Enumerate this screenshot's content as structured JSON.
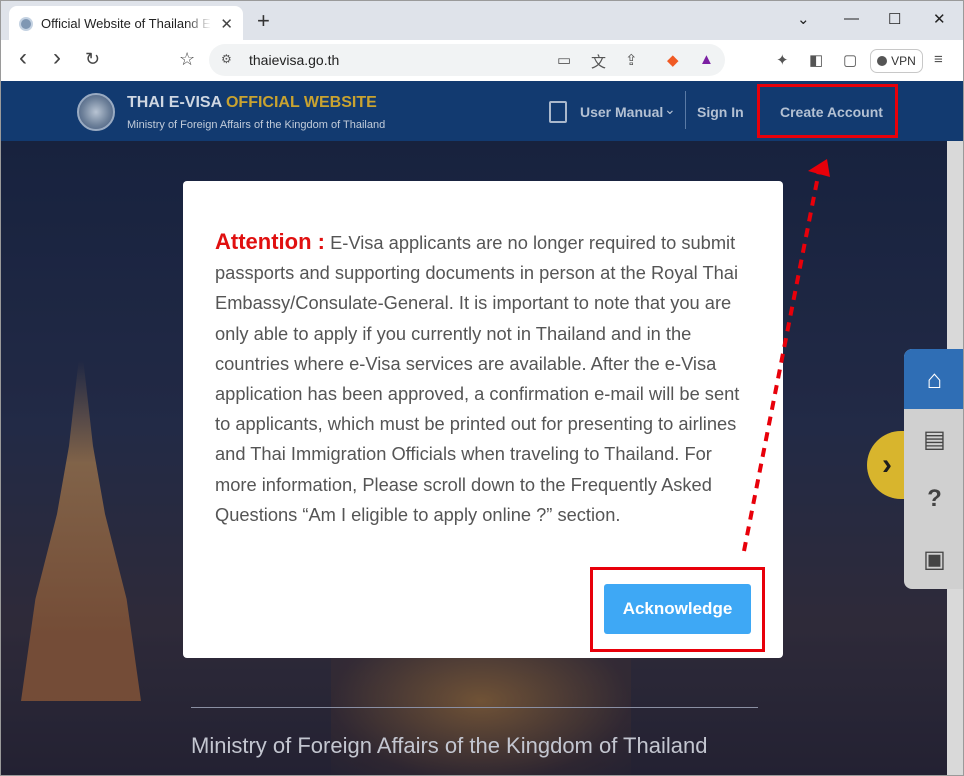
{
  "browser": {
    "tab_title": "Official Website of Thailand Electronic Visa",
    "tab_close": "✕",
    "new_tab": "+",
    "minimize": "⌄",
    "min": "—",
    "max": "☐",
    "close": "✕",
    "back": "‹",
    "forward": "›",
    "reload": "↻",
    "bookmark": "☆",
    "url": "thaievisa.go.th",
    "vpn_label": "VPN"
  },
  "site": {
    "brand_title_main": "THAI E-VISA",
    "brand_title_accent": "OFFICIAL WEBSITE",
    "brand_subtitle": "Ministry of Foreign Affairs of the Kingdom of Thailand",
    "nav": {
      "user_manual": "User Manual",
      "user_manual_caret": "⌄",
      "sign_in": "Sign In",
      "create_account": "Create Account"
    },
    "footer_title": "Ministry of Foreign Affairs of the Kingdom of Thailand"
  },
  "modal": {
    "attention_label": "Attention :",
    "body": "E-Visa applicants are no longer required to submit passports and supporting documents in person at the Royal Thai Embassy/Consulate-General. It is important to note that you are only able to apply if you currently not in Thailand and in the countries where e-Visa services are available. After the e-Visa application has been approved, a confirmation e-mail will be sent to applicants, which must be printed out for presenting to airlines and Thai Immigration Officials when traveling to Thailand. For more information, Please scroll down to the Frequently Asked Questions “Am I eligible to apply online ?” section.",
    "acknowledge_button": "Acknowledge"
  },
  "side_panel": {
    "toggle_glyph": "›",
    "home_icon": "⌂",
    "manual_icon": "▤",
    "faq_icon": "?",
    "passport_icon": "▣"
  },
  "colors": {
    "header_bg": "#123a70",
    "accent_gold": "#c9a330",
    "attention_red": "#e01010",
    "button_blue": "#3ea8f5",
    "annotation_red": "#e8000a"
  }
}
